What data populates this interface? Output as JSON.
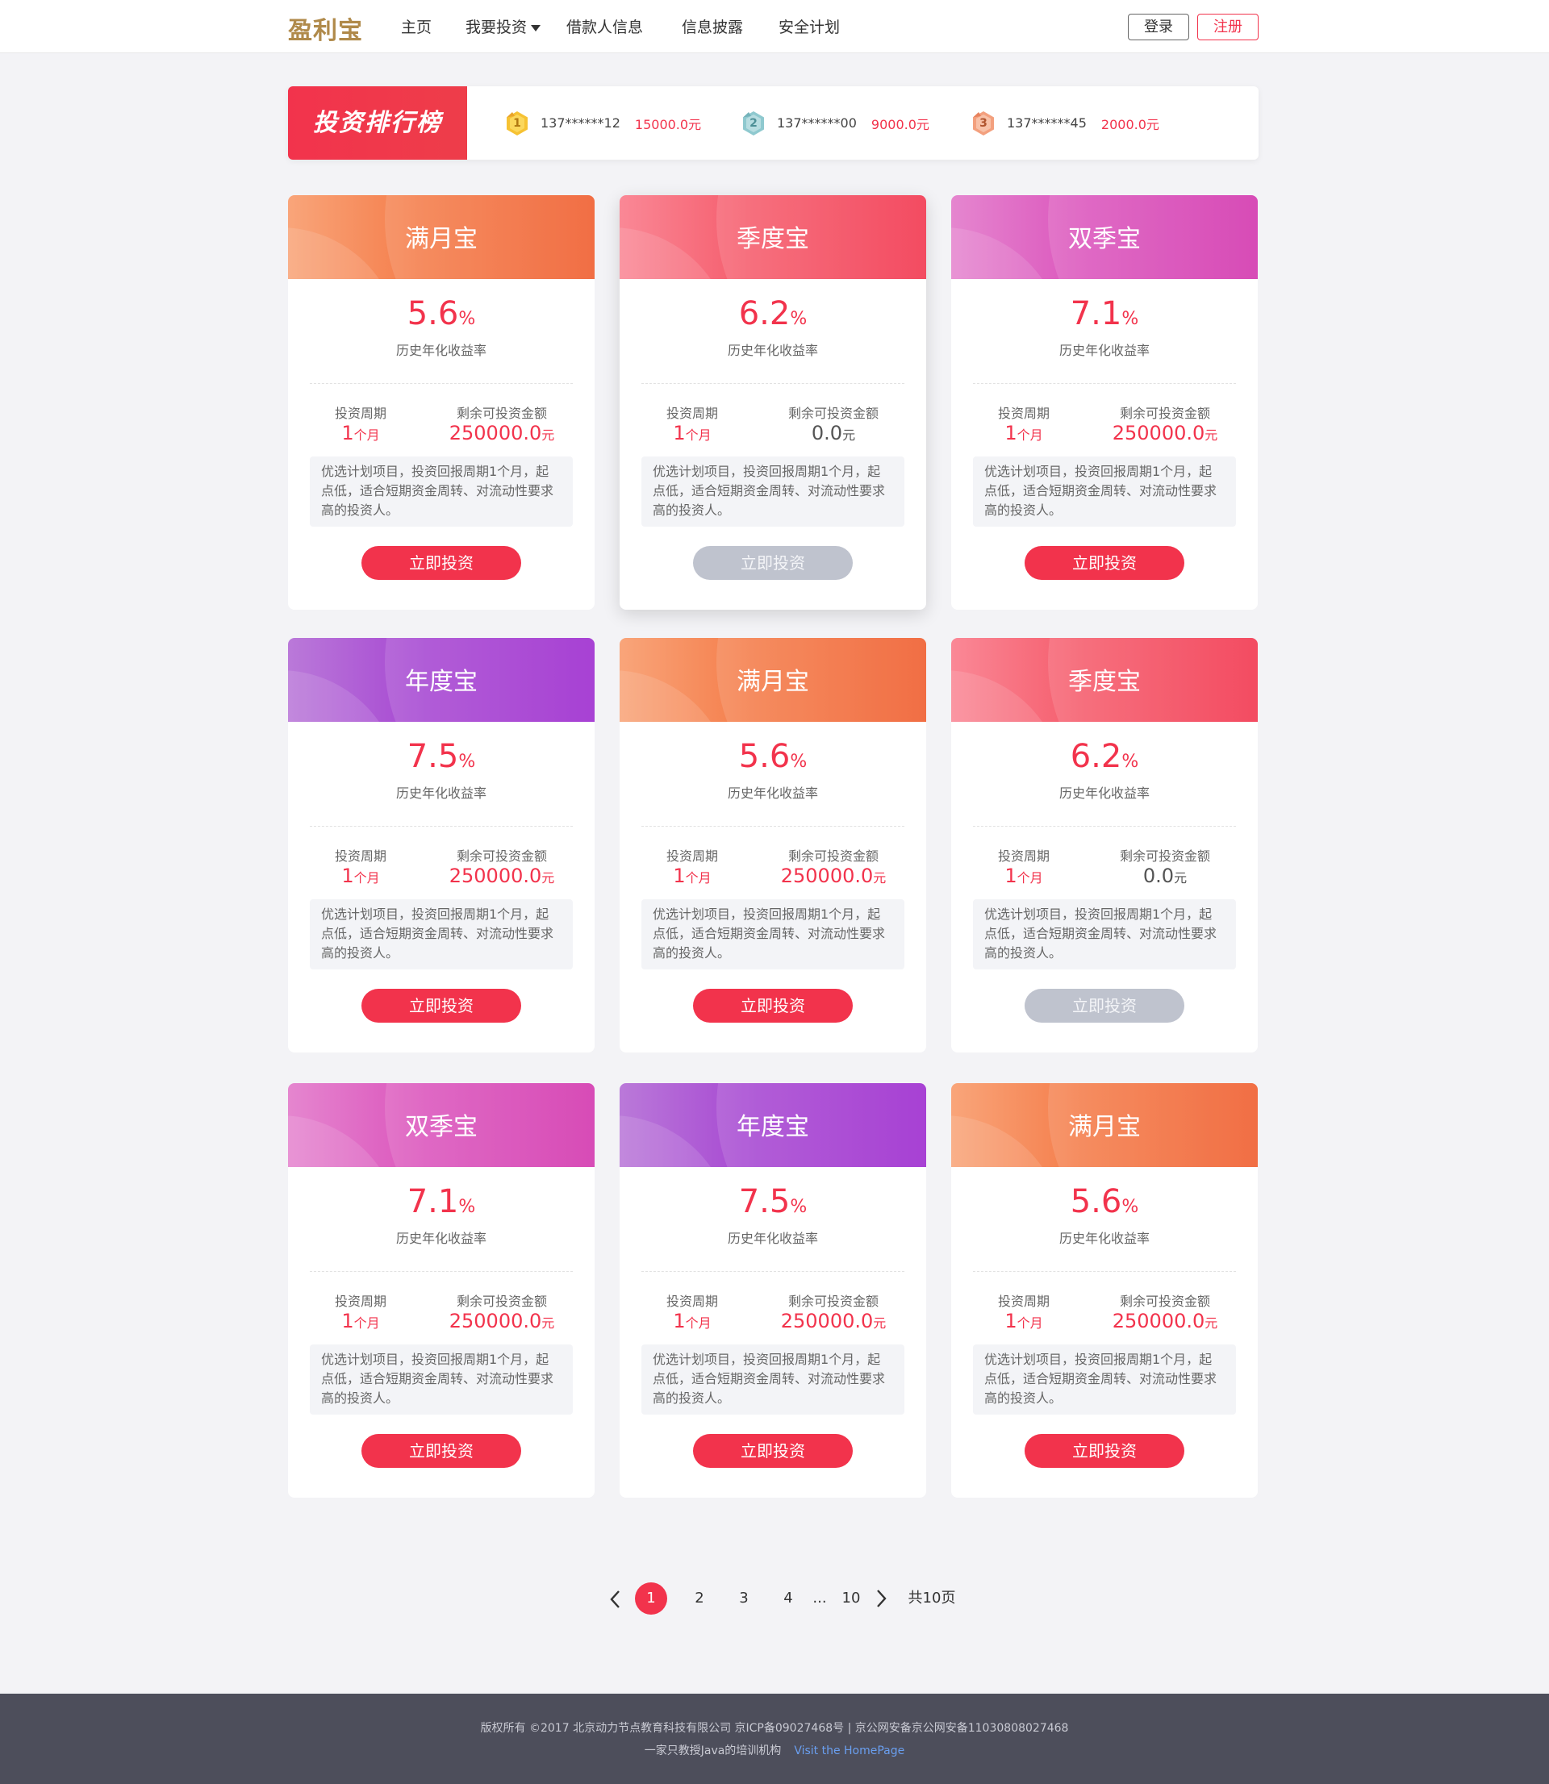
{
  "header": {
    "logo": "盈利宝",
    "nav": [
      "主页",
      "我要投资",
      "借款人信息",
      "信息披露",
      "安全计划"
    ],
    "login": "登录",
    "register": "注册"
  },
  "ranking": {
    "title": "投资排行榜",
    "entries": [
      {
        "rank": "1",
        "user": "137******12",
        "amount": "15000.0元"
      },
      {
        "rank": "2",
        "user": "137******00",
        "amount": "9000.0元"
      },
      {
        "rank": "3",
        "user": "137******45",
        "amount": "2000.0元"
      }
    ]
  },
  "labels": {
    "rate_label": "历史年化收益率",
    "period_label": "投资周期",
    "remain_label": "剩余可投资金额",
    "pct_unit": "%",
    "month_unit": "个月",
    "yuan_unit": "元",
    "button": "立即投资",
    "desc": "优选计划项目，投资回报周期1个月，起点低，适合短期资金周转、对流动性要求高的投资人。"
  },
  "products": [
    {
      "name": "满月宝",
      "rate": "5.6",
      "period": "1",
      "remain": "250000.0",
      "available": true
    },
    {
      "name": "季度宝",
      "rate": "6.2",
      "period": "1",
      "remain": "0.0",
      "available": false
    },
    {
      "name": "双季宝",
      "rate": "7.1",
      "period": "1",
      "remain": "250000.0",
      "available": true
    },
    {
      "name": "年度宝",
      "rate": "7.5",
      "period": "1",
      "remain": "250000.0",
      "available": true
    },
    {
      "name": "满月宝",
      "rate": "5.6",
      "period": "1",
      "remain": "250000.0",
      "available": true
    },
    {
      "name": "季度宝",
      "rate": "6.2",
      "period": "1",
      "remain": "0.0",
      "available": false
    },
    {
      "name": "双季宝",
      "rate": "7.1",
      "period": "1",
      "remain": "250000.0",
      "available": true
    },
    {
      "name": "年度宝",
      "rate": "7.5",
      "period": "1",
      "remain": "250000.0",
      "available": true
    },
    {
      "name": "满月宝",
      "rate": "5.6",
      "period": "1",
      "remain": "250000.0",
      "available": true
    }
  ],
  "pagination": {
    "prev_icon": "chevron-left-icon",
    "next_icon": "chevron-right-icon",
    "pages": [
      "1",
      "2",
      "3",
      "4"
    ],
    "ellipsis": "...",
    "last": "10",
    "total": "共10页",
    "current": "1"
  },
  "footer": {
    "line1": "版权所有 ©2017 北京动力节点教育科技有限公司 京ICP备09027468号 | 京公网安备京公网安备11030808027468",
    "line2": "一家只教授Java的培训机构",
    "link": "Visit the HomePage"
  },
  "colors": {
    "accent": "#f2334c",
    "disabled": "#bfc3ce",
    "footer_bg": "#4d4e5b"
  }
}
